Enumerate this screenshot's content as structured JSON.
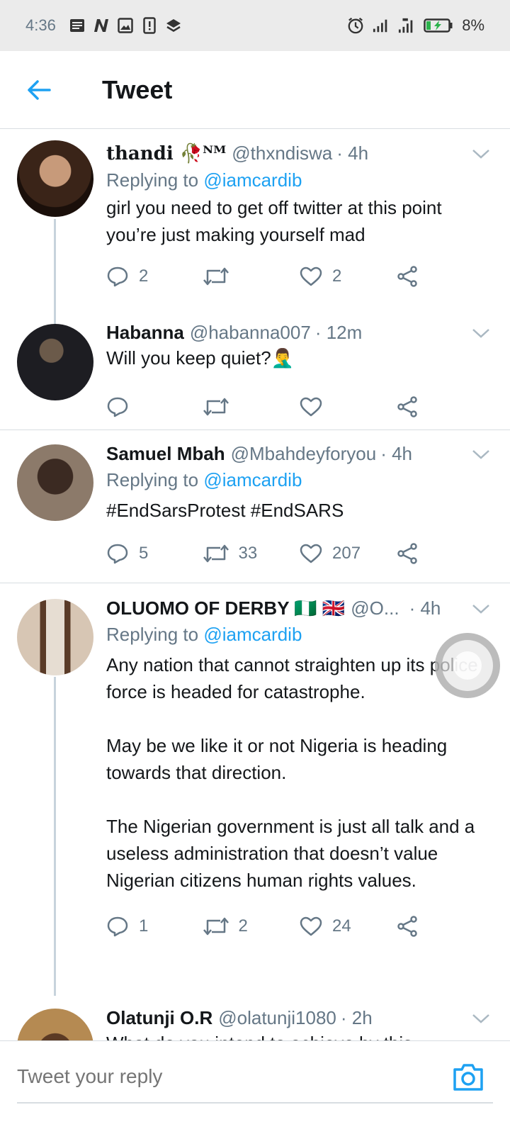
{
  "status": {
    "time": "4:36",
    "battery": "8%"
  },
  "header": {
    "title": "Tweet"
  },
  "tweets": [
    {
      "name": "thandi 🥀ᴺᴹ",
      "handle": "@thxndiswa",
      "time": "· 4h",
      "reply_label": "Replying to",
      "reply_to": "@iamcardib",
      "text": "girl you need to get off twitter at this point you’re just making yourself mad",
      "replies": "2",
      "retweets": "",
      "likes": "2"
    },
    {
      "name": "Habanna",
      "handle": "@habanna007",
      "time": "· 12m",
      "text": "Will you keep quiet?🤦‍♂️",
      "replies": "",
      "retweets": "",
      "likes": ""
    },
    {
      "name": "Samuel Mbah",
      "handle": "@Mbahdeyforyou",
      "time": "· 4h",
      "reply_label": "Replying to",
      "reply_to": "@iamcardib",
      "hashtags": "#EndSarsProtest #EndSARS",
      "replies": "5",
      "retweets": "33",
      "likes": "207"
    },
    {
      "name": "OLUOMO OF DERBY 🇳🇬 🇬🇧",
      "handle": "@O...",
      "time": "· 4h",
      "reply_label": "Replying to",
      "reply_to": "@iamcardib",
      "text": "Any nation that cannot straighten up its police force is headed for catastrophe.\n\nMay be we like it or not Nigeria is heading towards that direction.\n\nThe Nigerian government is just all talk and a useless administration that doesn’t value Nigerian citizens human rights values.",
      "replies": "1",
      "retweets": "2",
      "likes": "24"
    },
    {
      "name": "Olatunji O.R",
      "handle": "@olatunji1080",
      "time": "· 2h",
      "text": "What do you intend to achieve by this"
    }
  ],
  "composer": {
    "placeholder": "Tweet your reply"
  },
  "colors": {
    "accent": "#1da1f2",
    "muted": "#657786",
    "divider": "#d8dde1"
  }
}
